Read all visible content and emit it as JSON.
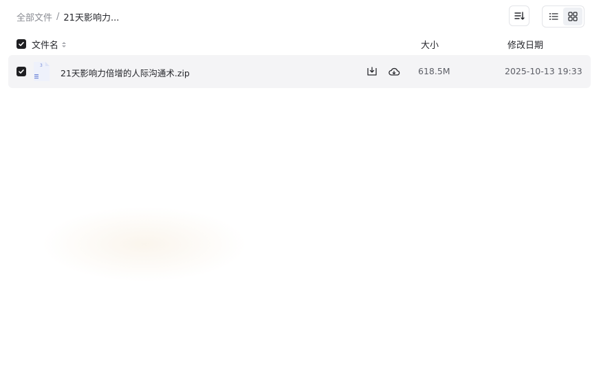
{
  "breadcrumb": {
    "root": "全部文件",
    "separator": "/",
    "current": "21天影响力..."
  },
  "toolbar": {
    "sort_icon": "sort-icon",
    "list_view_icon": "list-view-icon",
    "grid_view_icon": "grid-view-icon",
    "active_view": "list"
  },
  "table": {
    "headers": {
      "name": "文件名",
      "size": "大小",
      "modified": "修改日期"
    },
    "rows": [
      {
        "name": "21天影响力倍增的人际沟通术.zip",
        "size": "618.5M",
        "modified": "2025-10-13 19:33",
        "checked": true,
        "file_icon": "zip-file-icon"
      }
    ]
  },
  "colors": {
    "checkbox": "#1f1f22",
    "row_selected_bg": "#f4f4f6",
    "muted_text": "#8a8c93",
    "primary_text": "#25262b"
  }
}
